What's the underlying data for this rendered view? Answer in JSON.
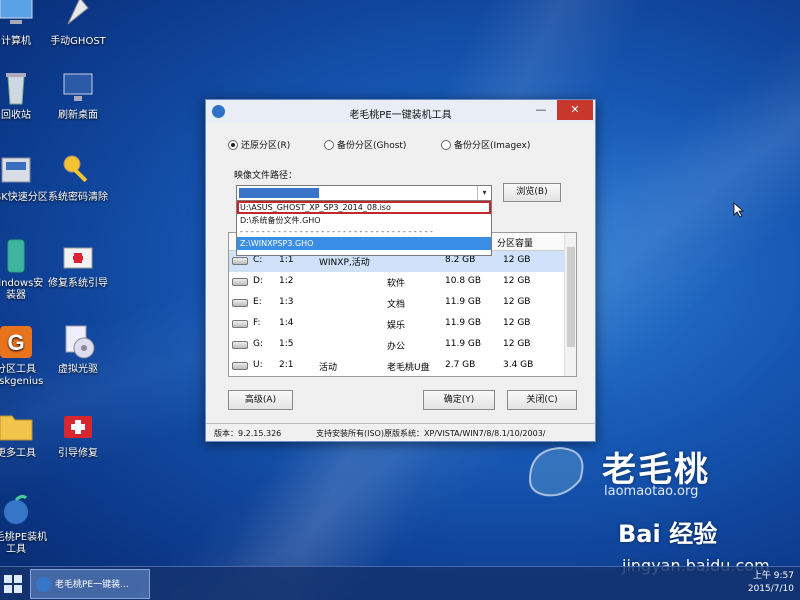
{
  "desktop": {
    "icons": [
      {
        "label": "计算机"
      },
      {
        "label": "手动GHOST"
      },
      {
        "label": "回收站"
      },
      {
        "label": "刷新桌面"
      },
      {
        "label": "DISK快速分区"
      },
      {
        "label": "系统密码清除"
      },
      {
        "label": "Windows安装器"
      },
      {
        "label": "修复系统引导"
      },
      {
        "label": "分区工具Diskgenius"
      },
      {
        "label": "虚拟光驱"
      },
      {
        "label": "更多工具"
      },
      {
        "label": "引导修复"
      },
      {
        "label": "老毛桃PE装机工具"
      }
    ]
  },
  "dialog": {
    "title": "老毛桃PE一键装机工具",
    "minimize": "—",
    "close": "✕",
    "radios": [
      {
        "label": "还原分区(R)",
        "checked": true
      },
      {
        "label": "备份分区(Ghost)",
        "checked": false
      },
      {
        "label": "备份分区(Imagex)",
        "checked": false
      }
    ],
    "image_path_label": "映像文件路径：",
    "browse_button": "浏览(B)",
    "dropdown_items": [
      {
        "text": "U:\\ASUS_GHOST_XP_SP3_2014_08.iso",
        "highlighted": true
      },
      {
        "text": "D:\\系统备份文件.GHO"
      },
      {
        "text": "- - - - - - - - - - - - - - - - - - - - - - - - - - - - - - - - - - - -"
      },
      {
        "text": "Z:\\WINXPSP3.GHO",
        "selected": true
      }
    ],
    "table_header_right": "分区容量",
    "table_rows": [
      {
        "drive": "C:",
        "part": "1:1",
        "type": "WINXP,活动",
        "label": "",
        "free": "8.2 GB",
        "cap": "12 GB"
      },
      {
        "drive": "D:",
        "part": "1:2",
        "type": "",
        "label": "软件",
        "free": "10.8 GB",
        "cap": "12 GB"
      },
      {
        "drive": "E:",
        "part": "1:3",
        "type": "",
        "label": "文档",
        "free": "11.9 GB",
        "cap": "12 GB"
      },
      {
        "drive": "F:",
        "part": "1:4",
        "type": "",
        "label": "娱乐",
        "free": "11.9 GB",
        "cap": "12 GB"
      },
      {
        "drive": "G:",
        "part": "1:5",
        "type": "",
        "label": "办公",
        "free": "11.9 GB",
        "cap": "12 GB"
      },
      {
        "drive": "U:",
        "part": "2:1",
        "type": "活动",
        "label": "老毛桃U盘",
        "free": "2.7 GB",
        "cap": "3.4 GB"
      }
    ],
    "buttons": {
      "advanced": "高级(A)",
      "ok": "确定(Y)",
      "close": "关闭(C)"
    },
    "status": {
      "version": "版本：9.2.15.326",
      "support": "支持安装所有(ISO)原版系统：XP/VISTA/WIN7/8/8.1/10/2003/"
    }
  },
  "taskbar": {
    "task_label": "老毛桃PE一键装...",
    "time": "上午 9:57",
    "date": "2015/7/10"
  },
  "watermarks": {
    "brand_cn": "老毛桃",
    "brand_url": "laomaotao.org",
    "baidu": "Bai 经验",
    "jingyan": "jingyan.baidu.com"
  },
  "colors": {
    "accent": "#2f73c8",
    "close": "#c7372c",
    "highlight_outline": "#c0282d"
  }
}
